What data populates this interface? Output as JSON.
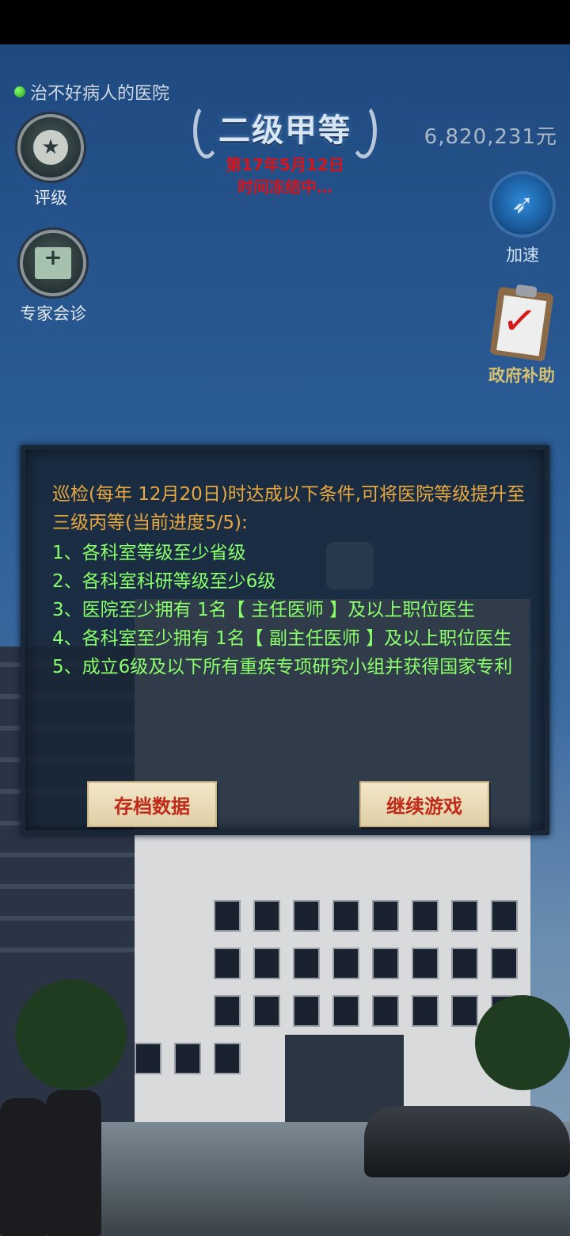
{
  "hospital": {
    "name": "治不好病人的医院",
    "grade": "二级甲等",
    "date": "第17年5月12日",
    "time_status": "时间冻结中…",
    "money": "6,820,231元"
  },
  "left_menu": {
    "rating_label": "评级",
    "consult_label": "专家会诊"
  },
  "right_menu": {
    "speed_label": "加速",
    "subsidy_label": "政府补助"
  },
  "dialog": {
    "intro": "巡检(每年 12月20日)时达成以下条件,可将医院等级提升至三级丙等(当前进度5/5):",
    "conditions": [
      "1、各科室等级至少省级",
      "2、各科室科研等级至少6级",
      "3、医院至少拥有 1名【 主任医师 】及以上职位医生",
      "4、各科室至少拥有 1名【 副主任医师 】及以上职位医生",
      "5、成立6级及以下所有重疾专项研究小组并获得国家专利"
    ],
    "save_button": "存档数据",
    "continue_button": "继续游戏"
  },
  "colors": {
    "condition_text": "#8aff6a",
    "intro_text": "#e8a840",
    "date_text": "#d8141a",
    "button_text": "#c02a18"
  }
}
